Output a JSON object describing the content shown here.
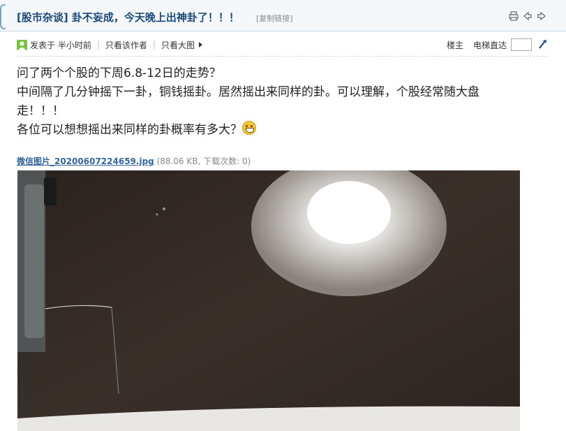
{
  "thread": {
    "title": "[股市杂谈] 卦不妄成，今天晚上出神卦了！！！",
    "copy_link": "[复制链接]"
  },
  "meta": {
    "posted": "发表于 半小时前",
    "only_author": "只看该作者",
    "only_images": "只看大图",
    "floor_label": "楼主",
    "jump_label": "电梯直达"
  },
  "post": {
    "lines": [
      "问了两个个股的下周6.8-12日的走势？",
      "中间隔了几分钟摇下一卦，铜钱摇卦。居然摇出来同样的卦。可以理解，个股经常随大盘",
      "走！！！",
      "各位可以想想摇出来同样的卦概率有多大？"
    ]
  },
  "attachment": {
    "filename": "微信图片_20200607224659.jpg",
    "info": " (88.06 KB, 下载次数: 0)"
  },
  "icons": {
    "print": "print-icon",
    "prev": "arrow-left-icon",
    "next": "arrow-right-icon",
    "jump": "jump-icon"
  }
}
